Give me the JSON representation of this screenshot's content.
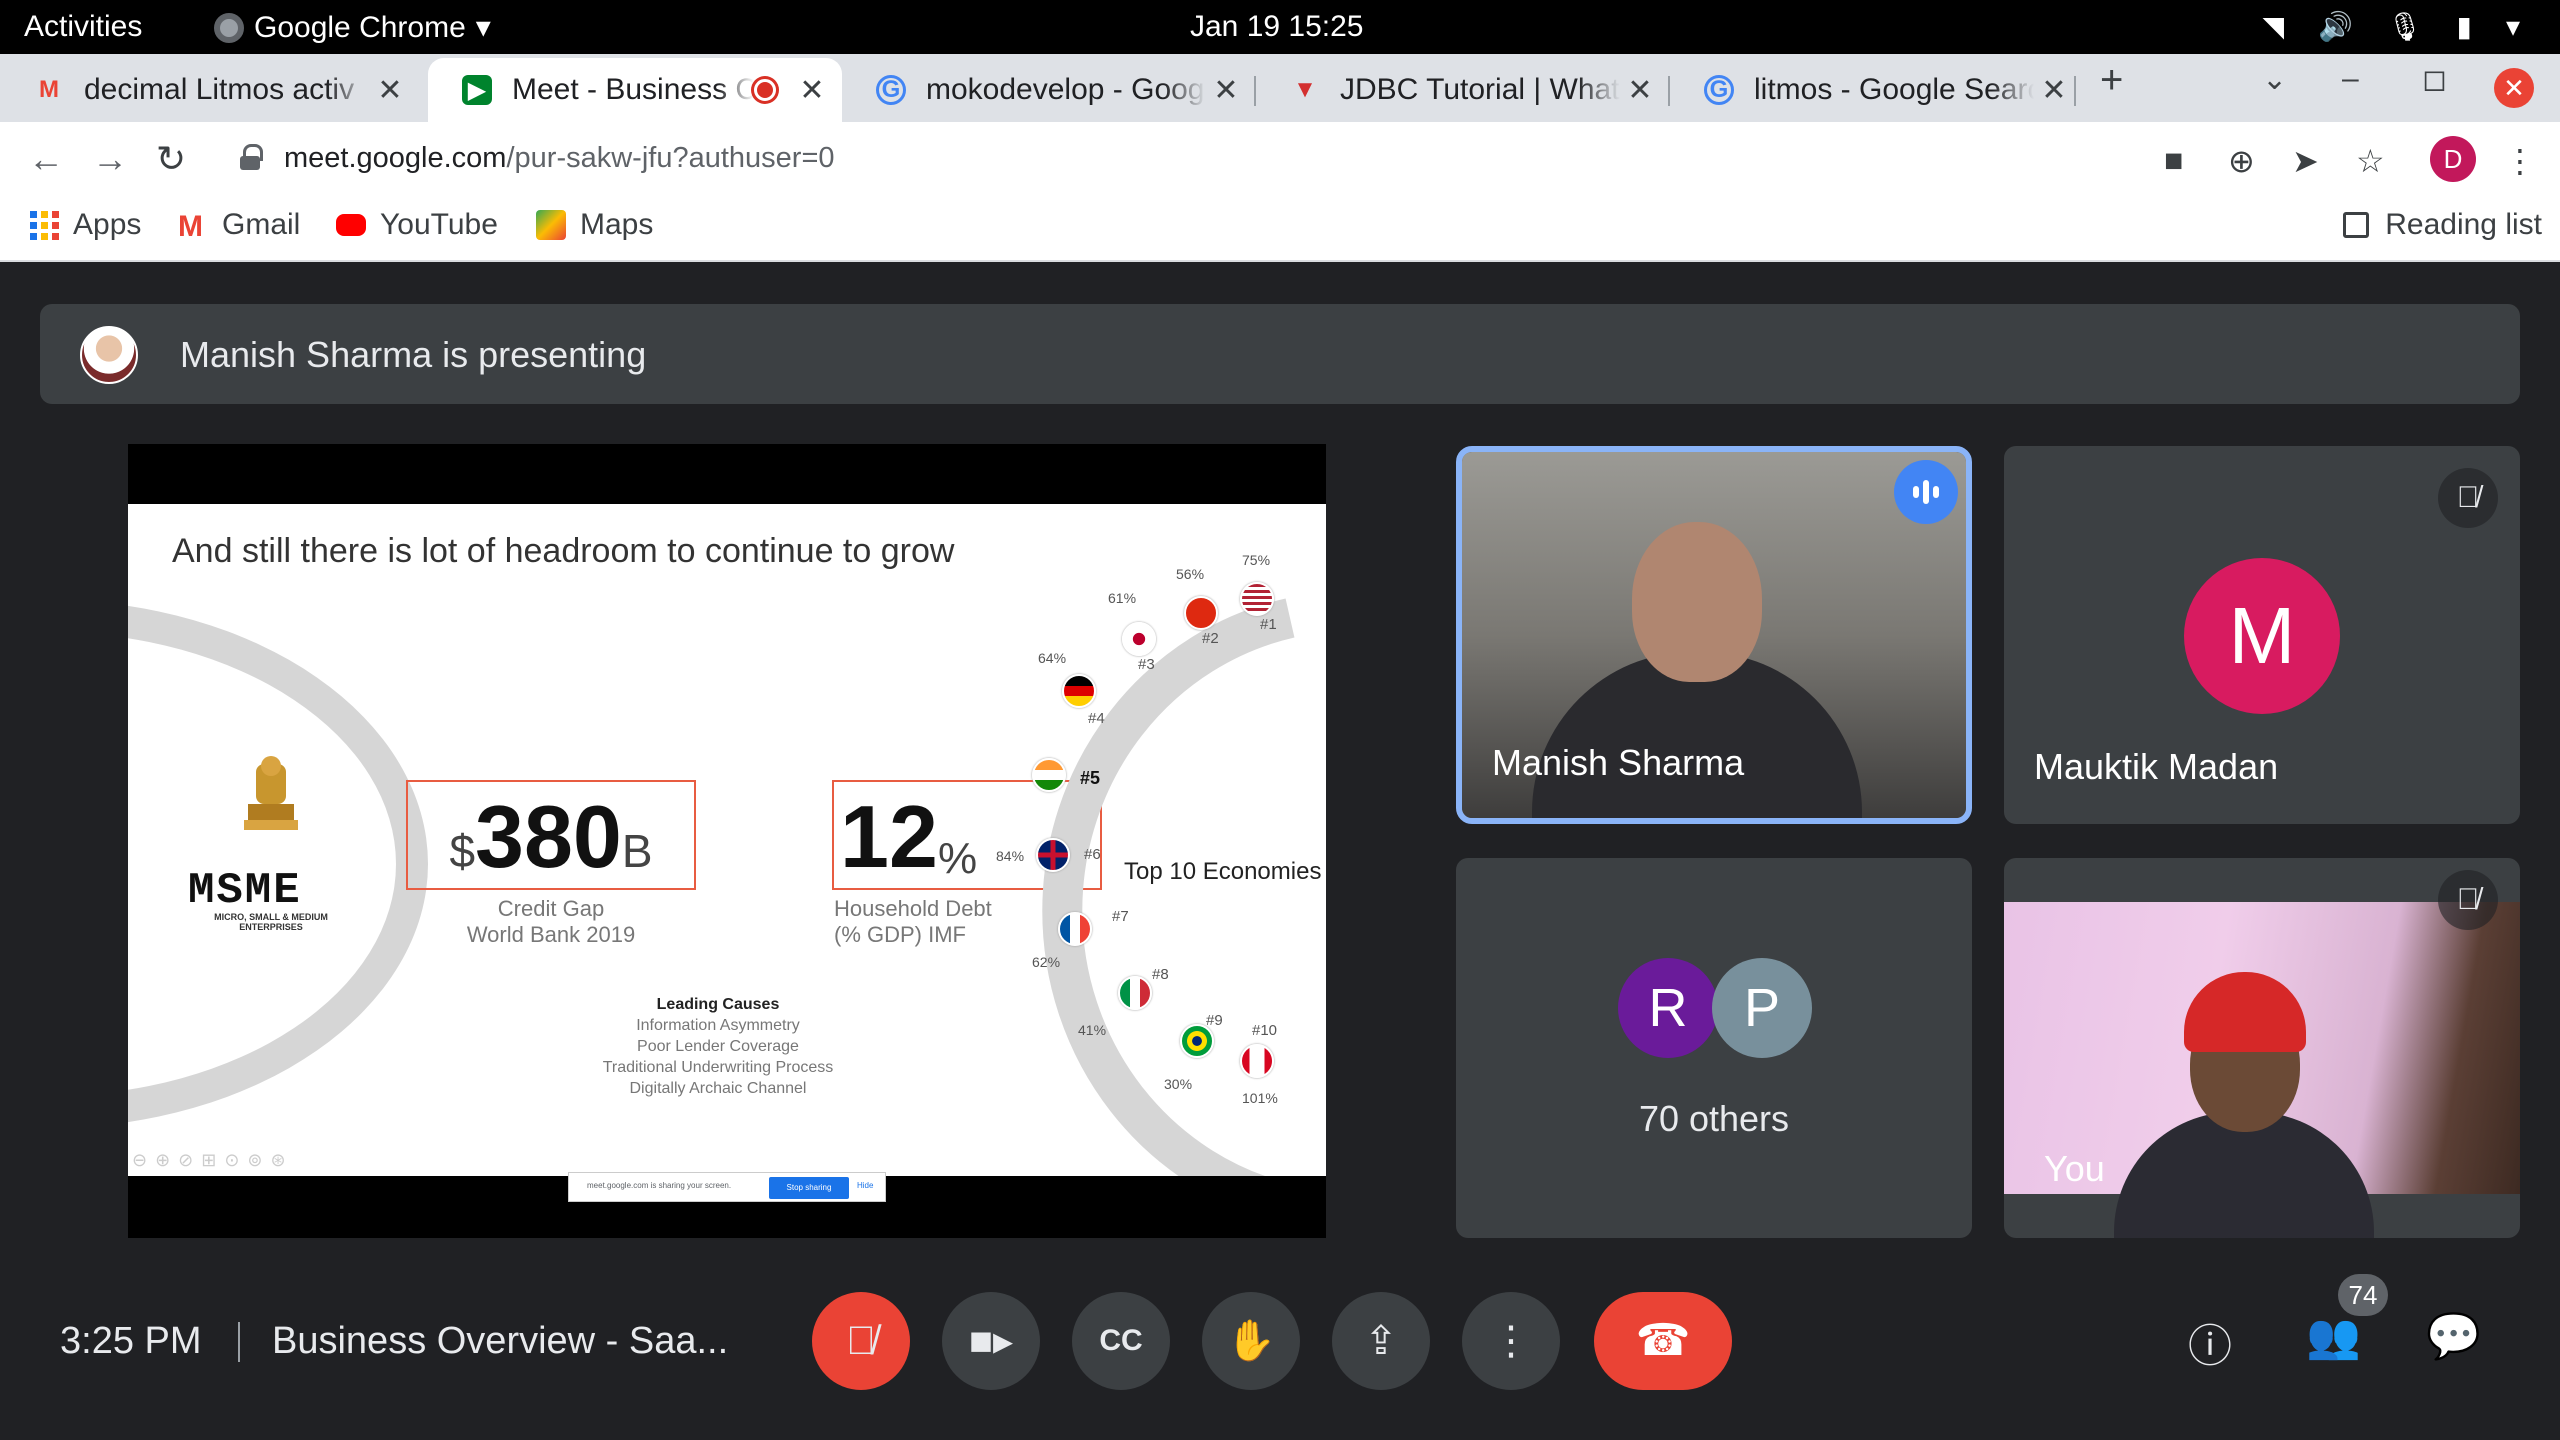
{
  "system": {
    "activities": "Activities",
    "app_name": "Google Chrome",
    "clock": "Jan 19  15:25"
  },
  "tabs": [
    {
      "title": "decimal Litmos activ",
      "favicon": "gmail-icon"
    },
    {
      "title": "Meet - Business C",
      "favicon": "meet-icon",
      "active": true,
      "recording": true
    },
    {
      "title": "mokodevelop - Goog",
      "favicon": "google-icon"
    },
    {
      "title": "JDBC Tutorial | What",
      "favicon": "jdbc-icon"
    },
    {
      "title": "litmos - Google Searc",
      "favicon": "google-icon"
    }
  ],
  "address": {
    "host": "meet.google.com",
    "path": "/pur-sakw-jfu?authuser=0"
  },
  "profile_initial": "D",
  "bookmarks": [
    "Apps",
    "Gmail",
    "YouTube",
    "Maps"
  ],
  "reading_list": "Reading list",
  "presenting": "Manish Sharma is presenting",
  "slide": {
    "title": "And still there is lot of headroom to continue to grow",
    "credit_currency": "$",
    "credit_value": "380",
    "credit_unit": "B",
    "credit_caption_1": "Credit Gap",
    "credit_caption_2": "World Bank 2019",
    "debt_value": "12",
    "debt_unit": "%",
    "debt_caption_1": "Household Debt",
    "debt_caption_2": "(% GDP) IMF",
    "causes_head": "Leading Causes",
    "causes": [
      "Information Asymmetry",
      "Poor Lender Coverage",
      "Traditional Underwriting Process",
      "Digitally Archaic Channel"
    ],
    "top10": "Top 10 Economies",
    "msme_logo": "MSME",
    "msme_sub": "MICRO, SMALL & MEDIUM ENTERPRISES",
    "economies": [
      {
        "rank": "#1",
        "pct": "75%",
        "country": "USA"
      },
      {
        "rank": "#2",
        "pct": "56%",
        "country": "China"
      },
      {
        "rank": "#3",
        "pct": "61%",
        "country": "Japan"
      },
      {
        "rank": "#4",
        "pct": "64%",
        "country": "Germany"
      },
      {
        "rank": "#5",
        "pct": "",
        "country": "India"
      },
      {
        "rank": "#6",
        "pct": "84%",
        "country": "UK"
      },
      {
        "rank": "#7",
        "pct": "62%",
        "country": "France"
      },
      {
        "rank": "#8",
        "pct": "41%",
        "country": "Italy"
      },
      {
        "rank": "#9",
        "pct": "30%",
        "country": "Brazil"
      },
      {
        "rank": "#10",
        "pct": "101%",
        "country": "Canada"
      }
    ]
  },
  "sharebar": {
    "message": "meet.google.com is sharing your screen.",
    "stop": "Stop sharing",
    "hide": "Hide"
  },
  "participants": {
    "presenter": "Manish Sharma",
    "second": "Mauktik Madan",
    "second_initial": "M",
    "others_initials": [
      "R",
      "P"
    ],
    "others_label": "70 others",
    "self": "You"
  },
  "bottom": {
    "time": "3:25 PM",
    "meeting": "Business Overview - Saa...",
    "participant_count": "74"
  },
  "colors": {
    "accent_blue": "#8ab4f8",
    "end_call_red": "#ea4335",
    "mauktik_avatar": "#d81b60",
    "r_avatar": "#6a1b9a",
    "p_avatar": "#78909c"
  }
}
